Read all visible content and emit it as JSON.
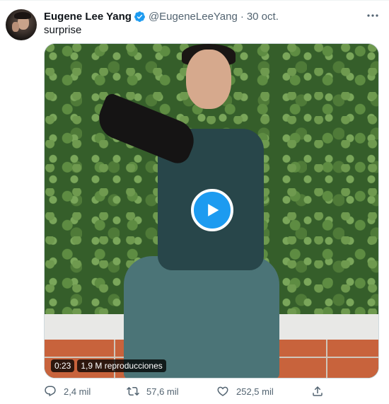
{
  "tweet": {
    "author_name": "Eugene Lee Yang",
    "handle": "@EugeneLeeYang",
    "separator": "·",
    "date": "30 oct.",
    "text": "surprise",
    "more_icon": "more-horizontal-icon",
    "verified_icon": "verified-badge-icon"
  },
  "media": {
    "duration": "0:23",
    "views": "1,9 M reproducciones",
    "play_icon": "play-icon"
  },
  "actions": {
    "replies": "2,4 mil",
    "retweets": "57,6 mil",
    "likes": "252,5 mil"
  },
  "colors": {
    "accent": "#1d9bf0",
    "text_primary": "#0f1419",
    "text_secondary": "#536471"
  }
}
